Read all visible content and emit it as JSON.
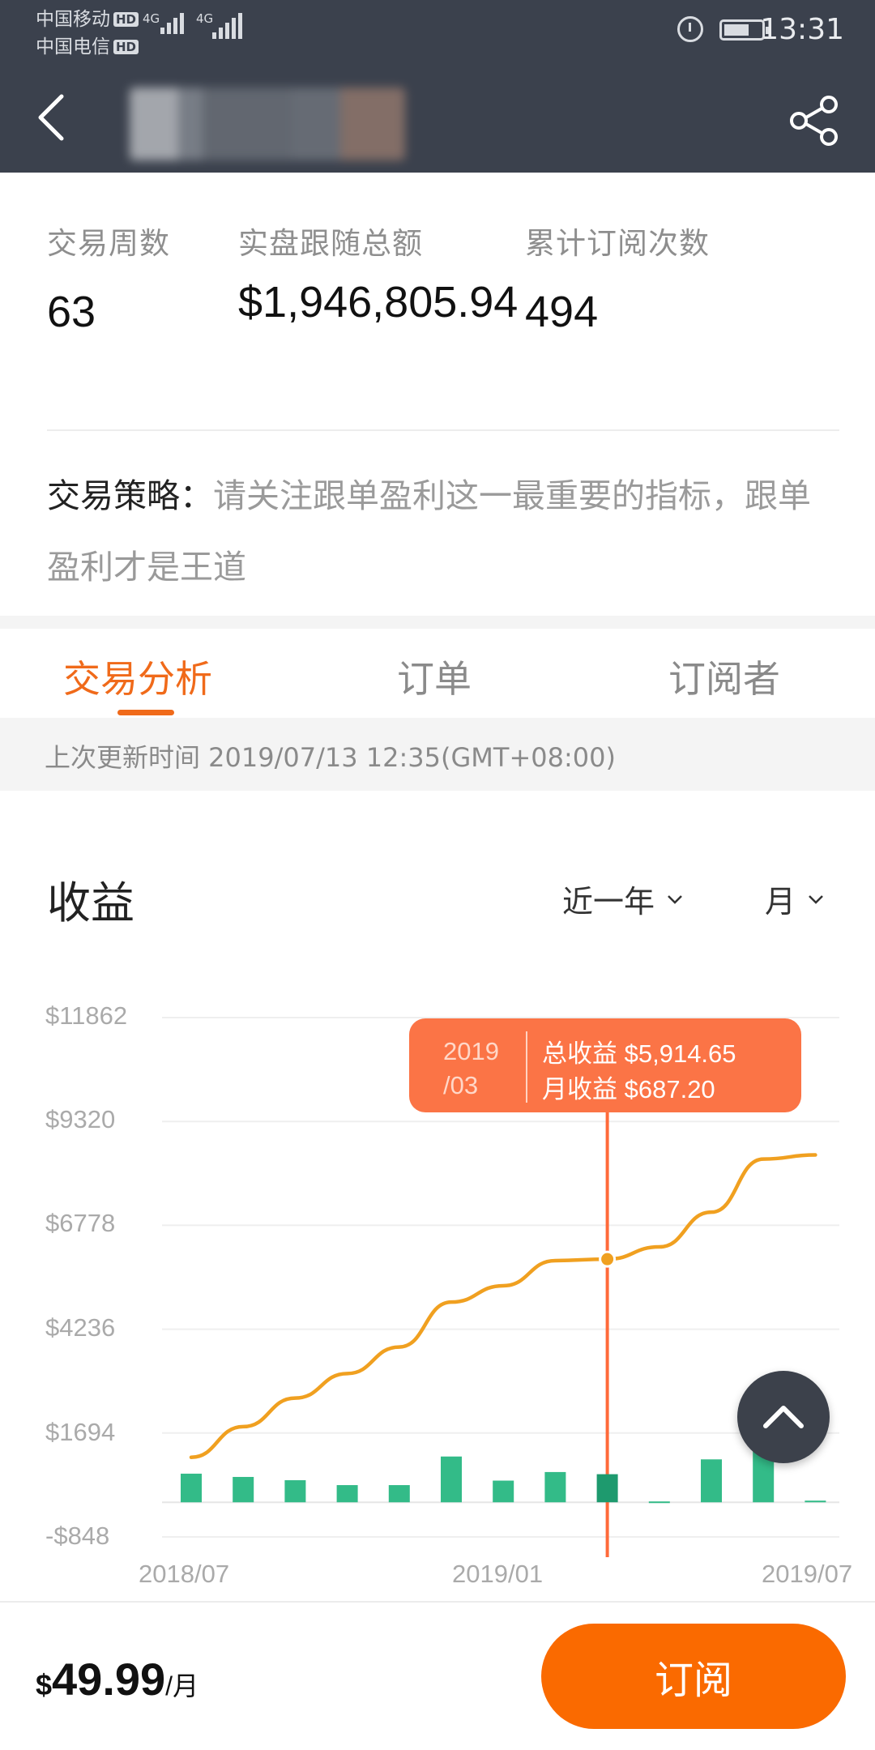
{
  "status_bar": {
    "carrier1": "中国移动",
    "carrier2": "中国电信",
    "hd_badge": "HD",
    "network1": "4G",
    "network2": "4G",
    "time": "13:31"
  },
  "stats": [
    {
      "label": "交易周数",
      "value": "63"
    },
    {
      "label": "实盘跟随总额",
      "value": "$1,946,805.94"
    },
    {
      "label": "累计订阅次数",
      "value": "494"
    }
  ],
  "strategy": {
    "label": "交易策略：",
    "text": "请关注跟单盈利这一最重要的指标，跟单盈利才是王道"
  },
  "tabs": [
    "交易分析",
    "订单",
    "订阅者"
  ],
  "update_text": "上次更新时间 2019/07/13 12:35(GMT+08:00)",
  "chart_section": {
    "title": "收益",
    "range_select": "近一年",
    "period_select": "月"
  },
  "tooltip": {
    "date_line1": "2019",
    "date_line2": "/03",
    "total": "总收益 $5,914.65",
    "monthly": "月收益 $687.20"
  },
  "chart_data": {
    "type": "line+bar",
    "y_ticks": [
      "$11862",
      "$9320",
      "$6778",
      "$4236",
      "$1694",
      "-$848"
    ],
    "ylim": [
      -848,
      11862
    ],
    "x_tick_labels": [
      "2018/07",
      "2019/01",
      "2019/07"
    ],
    "x": [
      "2018/07",
      "2018/08",
      "2018/09",
      "2018/10",
      "2018/11",
      "2018/12",
      "2019/01",
      "2019/02",
      "2019/03",
      "2019/04",
      "2019/05",
      "2019/06",
      "2019/07"
    ],
    "series": [
      {
        "type": "line",
        "color": "#f0a020",
        "values": [
          1100,
          1850,
          2550,
          3150,
          3800,
          4900,
          5300,
          5914.65,
          5950,
          6250,
          7100,
          8400,
          8500
        ]
      },
      {
        "type": "bar",
        "color": "#33bb88",
        "values": [
          700,
          620,
          540,
          420,
          420,
          1120,
          530,
          740,
          687.2,
          20,
          1050,
          1450,
          40
        ]
      }
    ],
    "highlight_index": 8,
    "highlight_color": "#ff6a3a"
  },
  "bottom": {
    "currency": "$",
    "price": "49.99",
    "unit": "/月",
    "subscribe_label": "订阅"
  }
}
